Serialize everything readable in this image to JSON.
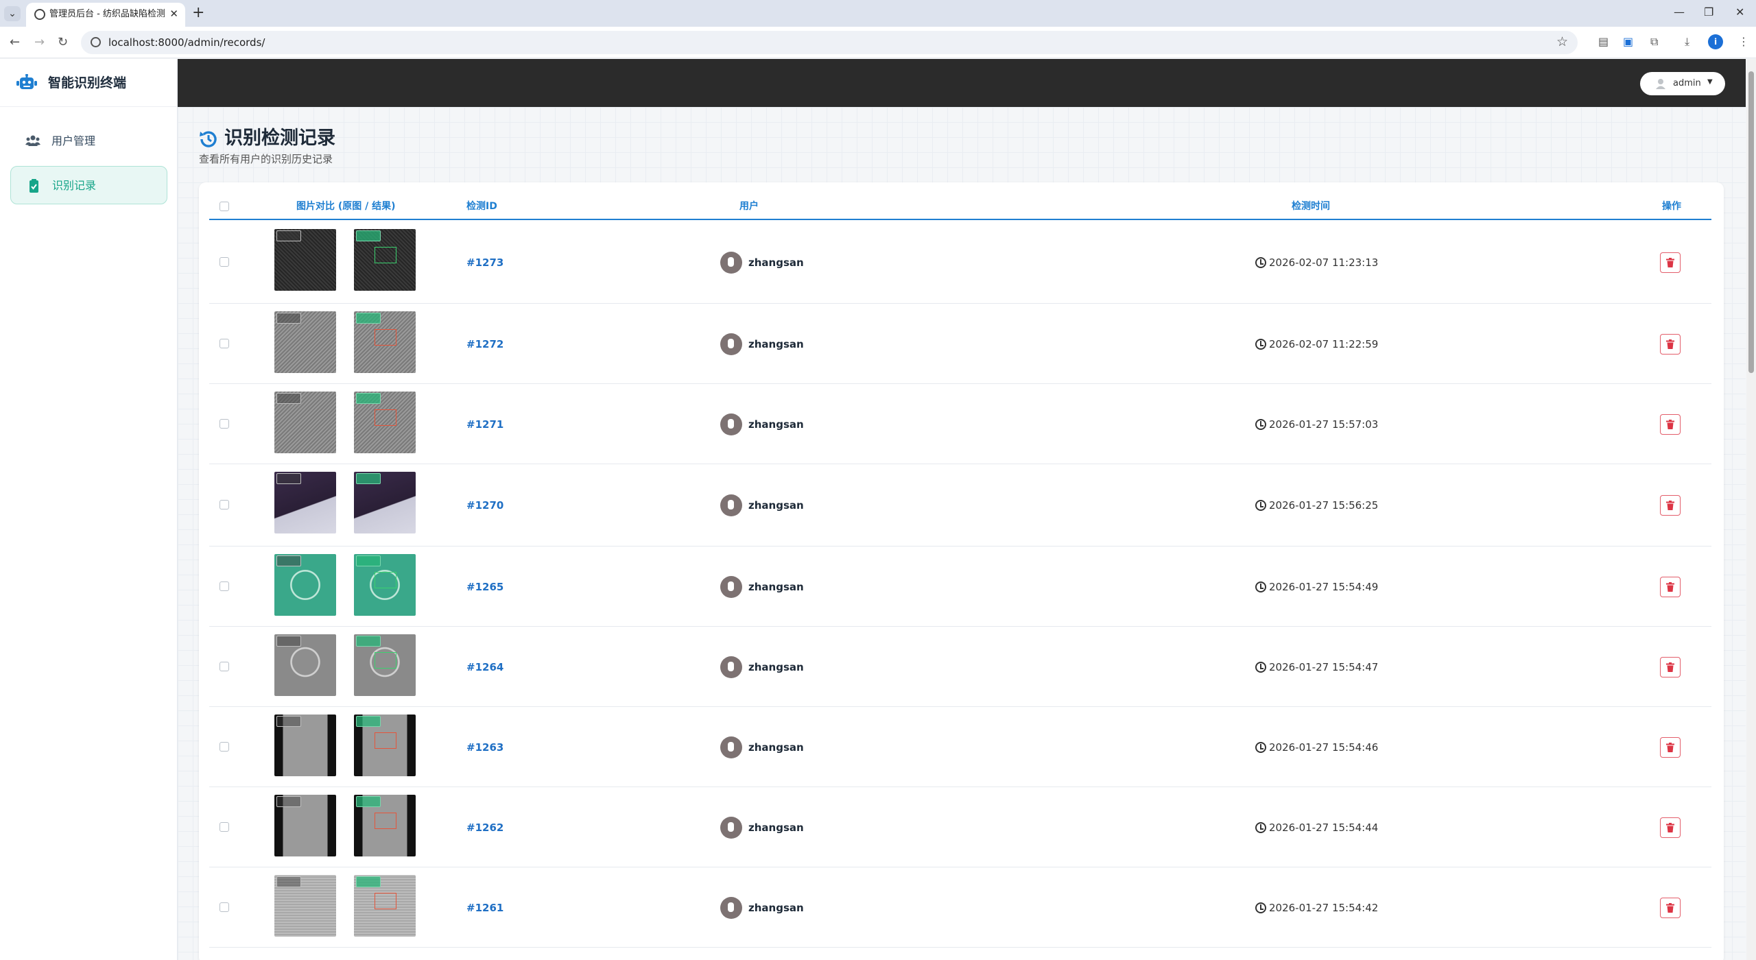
{
  "browser": {
    "tab_title": "管理员后台 - 纺织品缺陷检测系",
    "url": "localhost:8000/admin/records/",
    "profile_initial": "i"
  },
  "sidebar": {
    "brand": "智能识别终端",
    "items": [
      {
        "label": "用户管理",
        "icon": "users-icon",
        "active": false
      },
      {
        "label": "识别记录",
        "icon": "clipboard-check-icon",
        "active": true
      }
    ]
  },
  "topbar": {
    "user": "admin"
  },
  "page": {
    "title": "识别检测记录",
    "subtitle": "查看所有用户的识别历史记录",
    "accent": "#1f7fd1",
    "active_color": "#17a589",
    "danger": "#dc3545"
  },
  "table": {
    "headers": {
      "compare": "图片对比 (原图 / 结果)",
      "id": "检测ID",
      "user": "用户",
      "time": "检测时间",
      "action": "操作"
    },
    "rows": [
      {
        "id": "#1273",
        "user": "zhangsan",
        "time": "2026-02-07 11:23:13",
        "theme": "dark-mesh",
        "box": "green"
      },
      {
        "id": "#1272",
        "user": "zhangsan",
        "time": "2026-02-07 11:22:59",
        "theme": "grey-fabric",
        "box": "red"
      },
      {
        "id": "#1271",
        "user": "zhangsan",
        "time": "2026-01-27 15:57:03",
        "theme": "grey-fabric",
        "box": "red"
      },
      {
        "id": "#1270",
        "user": "zhangsan",
        "time": "2026-01-27 15:56:25",
        "theme": "purple-dark",
        "box": "none"
      },
      {
        "id": "#1265",
        "user": "zhangsan",
        "time": "2026-01-27 15:54:49",
        "theme": "teal-circle",
        "box": "green"
      },
      {
        "id": "#1264",
        "user": "zhangsan",
        "time": "2026-01-27 15:54:47",
        "theme": "grey-circle",
        "box": "green"
      },
      {
        "id": "#1263",
        "user": "zhangsan",
        "time": "2026-01-27 15:54:46",
        "theme": "dark-panel",
        "box": "red"
      },
      {
        "id": "#1262",
        "user": "zhangsan",
        "time": "2026-01-27 15:54:44",
        "theme": "dark-panel",
        "box": "red"
      },
      {
        "id": "#1261",
        "user": "zhangsan",
        "time": "2026-01-27 15:54:42",
        "theme": "light-texture",
        "box": "red"
      }
    ]
  }
}
